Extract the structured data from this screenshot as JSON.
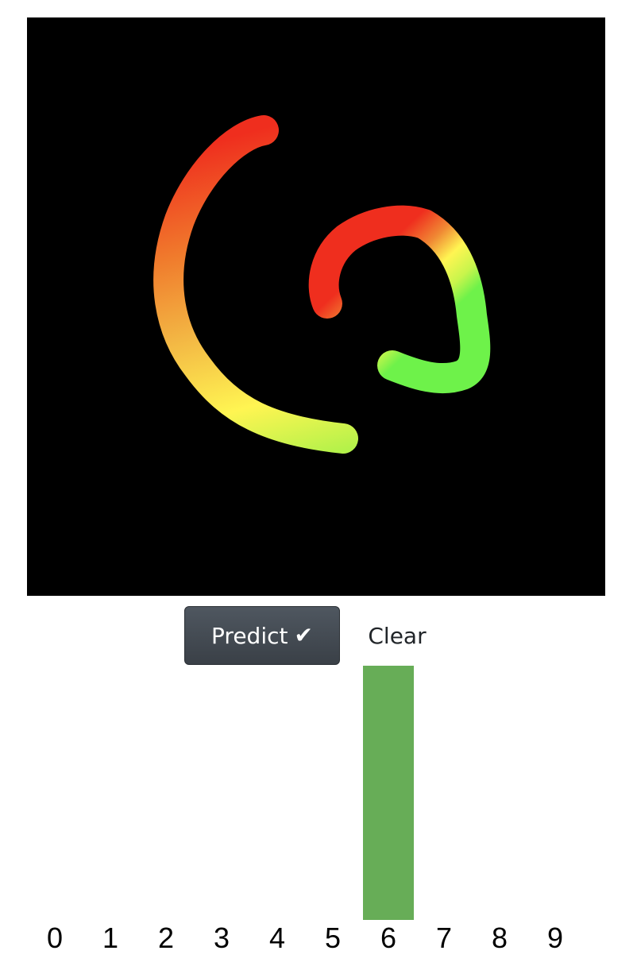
{
  "toolbar": {
    "predict_label": "Predict",
    "predict_icon": "check-icon",
    "clear_label": "Clear"
  },
  "canvas": {
    "background": "#000000",
    "stroke_gradient": [
      "#ef2e1e",
      "#f07a2c",
      "#fbd54a",
      "#fff552",
      "#a9f54a",
      "#6ef24a"
    ]
  },
  "colors": {
    "bar": "#67ad57",
    "predict_button": "#3f454d"
  },
  "chart_data": {
    "type": "bar",
    "categories": [
      "0",
      "1",
      "2",
      "3",
      "4",
      "5",
      "6",
      "7",
      "8",
      "9"
    ],
    "values": [
      0,
      0,
      0,
      0,
      0,
      0,
      1,
      0,
      0,
      0
    ],
    "ylim": [
      0,
      1
    ],
    "grid": false
  }
}
